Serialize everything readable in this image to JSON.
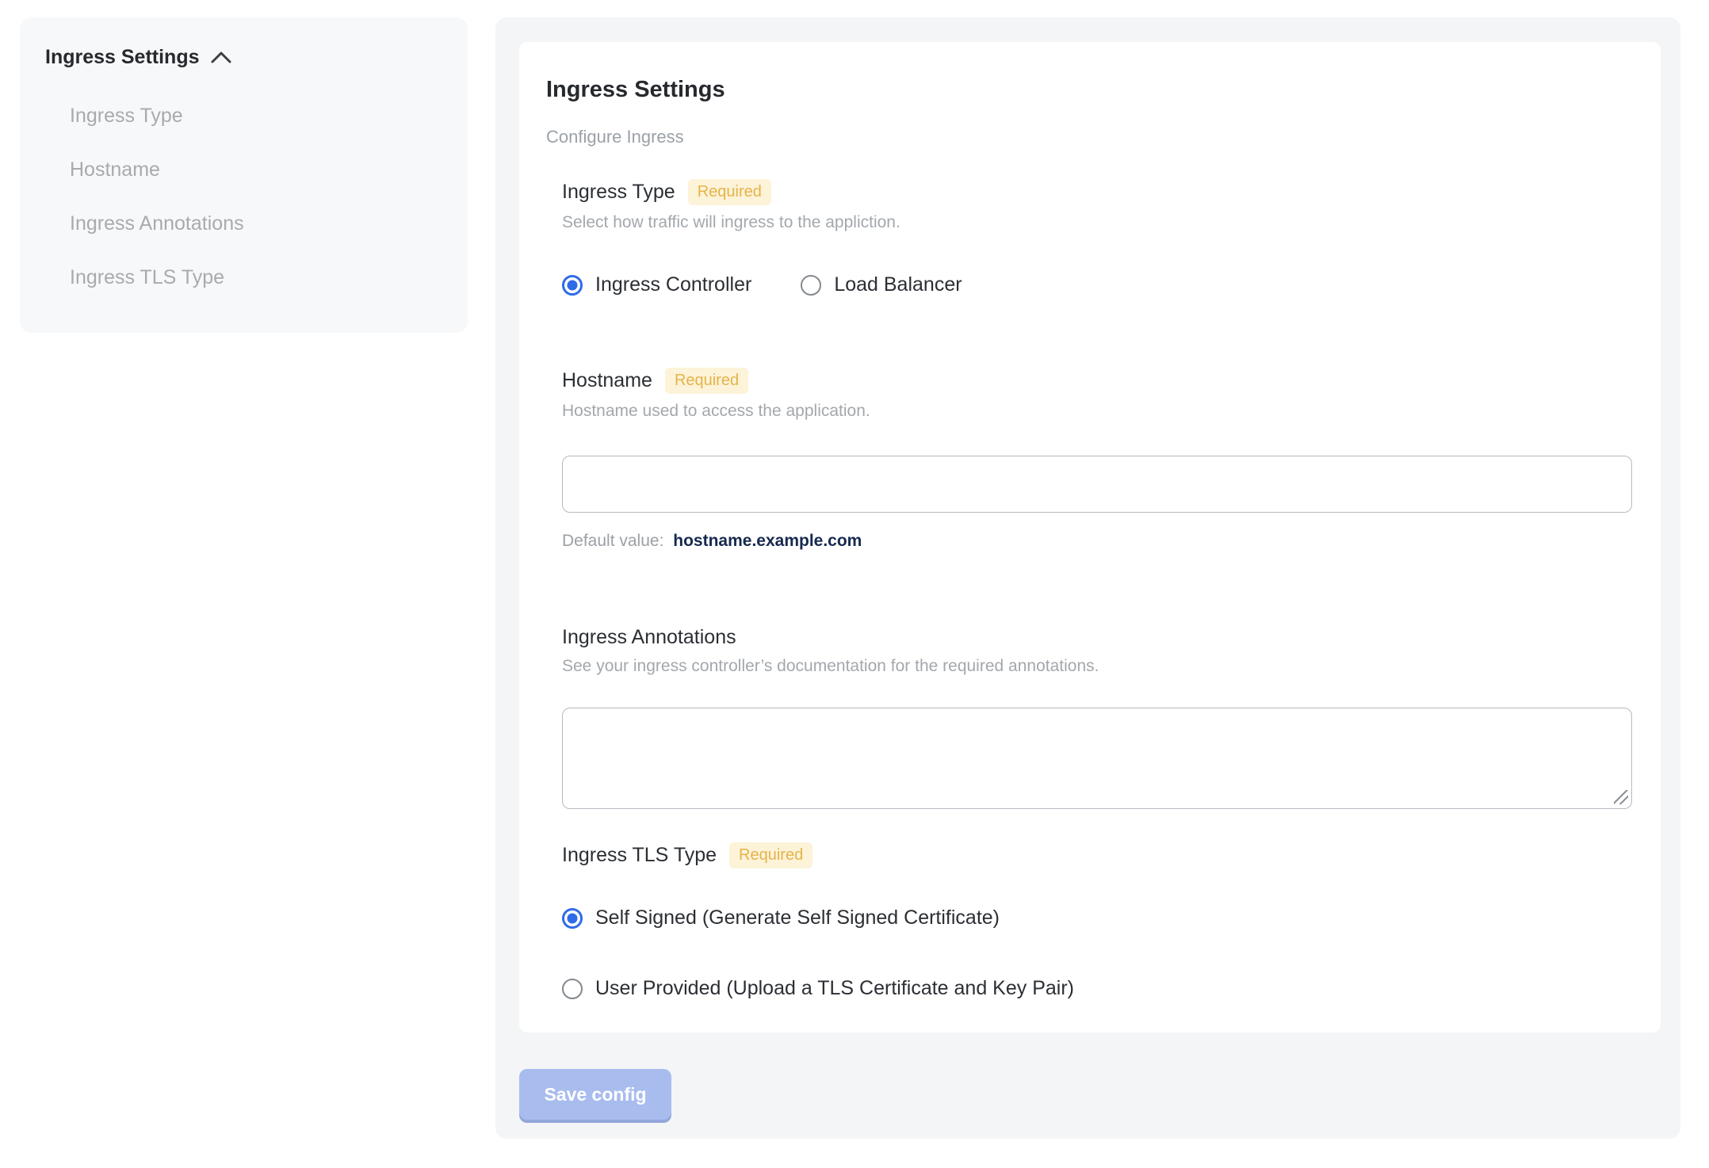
{
  "sidebar": {
    "header": "Ingress Settings",
    "items": [
      {
        "label": "Ingress Type"
      },
      {
        "label": "Hostname"
      },
      {
        "label": "Ingress Annotations"
      },
      {
        "label": "Ingress TLS Type"
      }
    ]
  },
  "main": {
    "title": "Ingress Settings",
    "subtitle": "Configure Ingress",
    "required_badge": "Required",
    "sections": {
      "ingress_type": {
        "label": "Ingress Type",
        "required": true,
        "description": "Select how traffic will ingress to the appliction.",
        "options": [
          {
            "label": "Ingress Controller",
            "selected": true
          },
          {
            "label": "Load Balancer",
            "selected": false
          }
        ]
      },
      "hostname": {
        "label": "Hostname",
        "required": true,
        "description": "Hostname used to access the application.",
        "input_value": "",
        "default_value_label": "Default value:",
        "default_value": "hostname.example.com"
      },
      "ingress_annotations": {
        "label": "Ingress Annotations",
        "required": false,
        "description": "See your ingress controller’s documentation for the required annotations.",
        "textarea_value": ""
      },
      "ingress_tls_type": {
        "label": "Ingress TLS Type",
        "required": true,
        "options": [
          {
            "label": "Self Signed (Generate Self Signed Certificate)",
            "selected": true
          },
          {
            "label": "User Provided (Upload a TLS Certificate and Key Pair)",
            "selected": false
          }
        ]
      }
    },
    "save_button_label": "Save config"
  },
  "colors": {
    "accent_blue": "#2e6be8",
    "badge_bg": "#fcf3d8",
    "badge_text": "#e7b34a",
    "save_button_bg": "#a9bcee",
    "default_value_text": "#16294e",
    "panel_bg": "#f3f5f7",
    "sidebar_bg": "#f7f8fa"
  }
}
